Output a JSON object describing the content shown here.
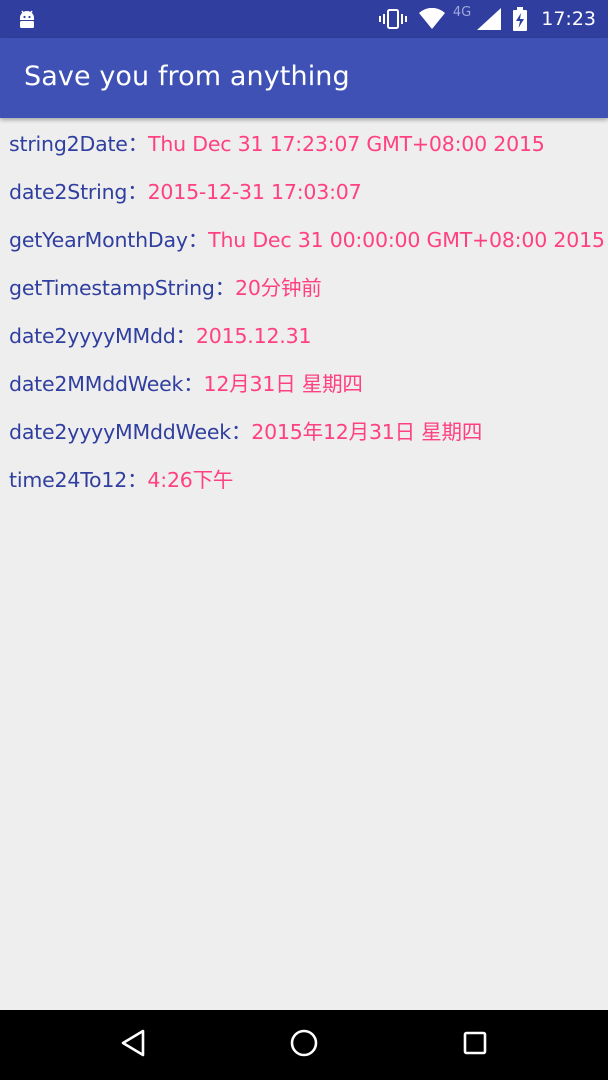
{
  "status_bar": {
    "network": "4G",
    "time": "17:23"
  },
  "app_bar": {
    "title": "Save you from anything"
  },
  "rows": [
    {
      "key": "string2Date",
      "separator": "：",
      "value": "Thu Dec 31 17:23:07 GMT+08:00 2015"
    },
    {
      "key": "date2String",
      "separator": "：",
      "value": "2015-12-31 17:03:07"
    },
    {
      "key": "getYearMonthDay",
      "separator": "：",
      "value": "Thu Dec 31 00:00:00 GMT+08:00 2015"
    },
    {
      "key": "getTimestampString",
      "separator": "：",
      "value": "20分钟前"
    },
    {
      "key": "date2yyyyMMdd",
      "separator": "：",
      "value": "2015.12.31"
    },
    {
      "key": "date2MMddWeek",
      "separator": "：",
      "value": "12月31日 星期四"
    },
    {
      "key": "date2yyyyMMddWeek",
      "separator": "：",
      "value": "2015年12月31日 星期四"
    },
    {
      "key": "time24To12",
      "separator": "：",
      "value": "4:26下午"
    }
  ],
  "icons": {
    "status_left": "android-debug-icon",
    "vibrate": "vibrate-icon",
    "wifi": "wifi-icon",
    "signal": "cell-signal-icon",
    "battery": "battery-charging-icon",
    "back": "back-icon",
    "home": "home-icon",
    "recents": "recents-icon"
  },
  "colors": {
    "status_bar": "#303f9f",
    "primary": "#3f51b5",
    "key_text": "#303f9f",
    "value_text": "#ff4081",
    "background": "#eeeeee",
    "nav_bar": "#000000"
  }
}
